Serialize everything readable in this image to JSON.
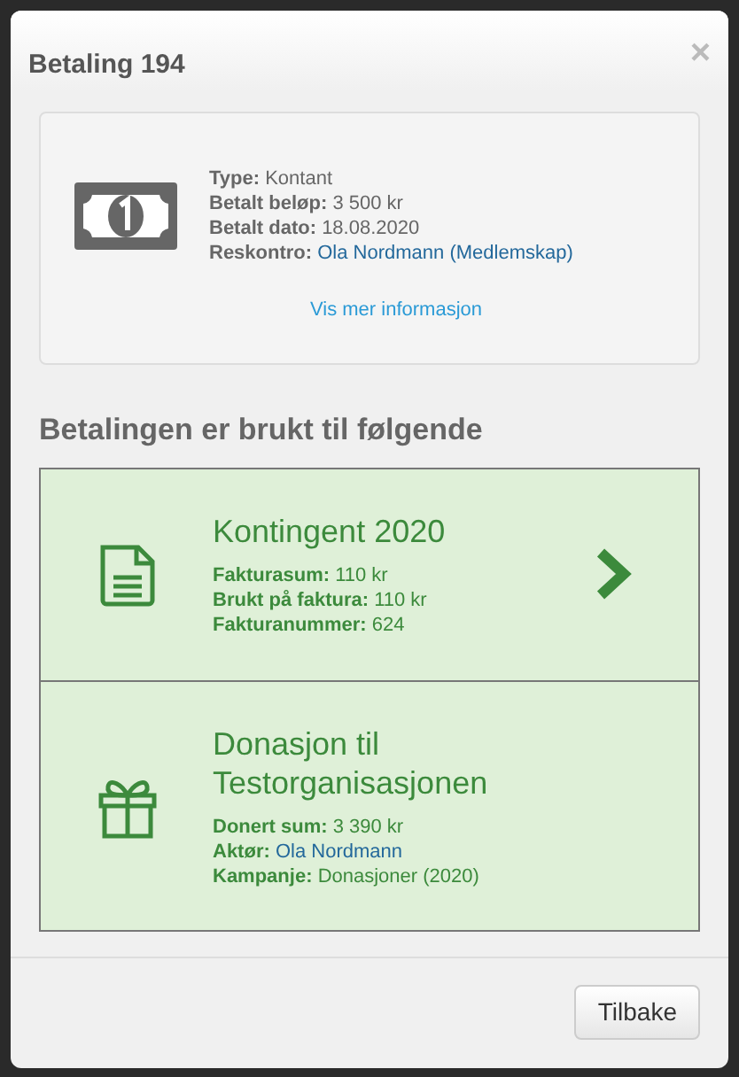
{
  "modal": {
    "title": "Betaling 194",
    "close": "×"
  },
  "payment": {
    "fields": [
      {
        "label": "Type:",
        "value": "Kontant",
        "link": false
      },
      {
        "label": "Betalt beløp:",
        "value": "3 500 kr",
        "link": false
      },
      {
        "label": "Betalt dato:",
        "value": "18.08.2020",
        "link": false
      },
      {
        "label": "Reskontro:",
        "value": "Ola Nordmann (Medlemskap)",
        "link": true
      }
    ],
    "more_link": "Vis mer informasjon"
  },
  "usage_heading": "Betalingen er brukt til følgende",
  "usages": [
    {
      "kind": "invoice",
      "title": "Kontingent 2020",
      "has_arrow": true,
      "fields": [
        {
          "label": "Fakturasum:",
          "value": "110 kr",
          "link": false
        },
        {
          "label": "Brukt på faktura:",
          "value": "110 kr",
          "link": false
        },
        {
          "label": "Fakturanummer:",
          "value": "624",
          "link": false
        }
      ]
    },
    {
      "kind": "donation",
      "title": "Donasjon til Testorganisasjonen",
      "has_arrow": false,
      "fields": [
        {
          "label": "Donert sum:",
          "value": "3 390 kr",
          "link": false
        },
        {
          "label": "Aktør:",
          "value": "Ola Nordmann",
          "link": true
        },
        {
          "label": "Kampanje:",
          "value": "Donasjoner (2020)",
          "link": false
        }
      ]
    }
  ],
  "footer": {
    "back_button": "Tilbake"
  }
}
